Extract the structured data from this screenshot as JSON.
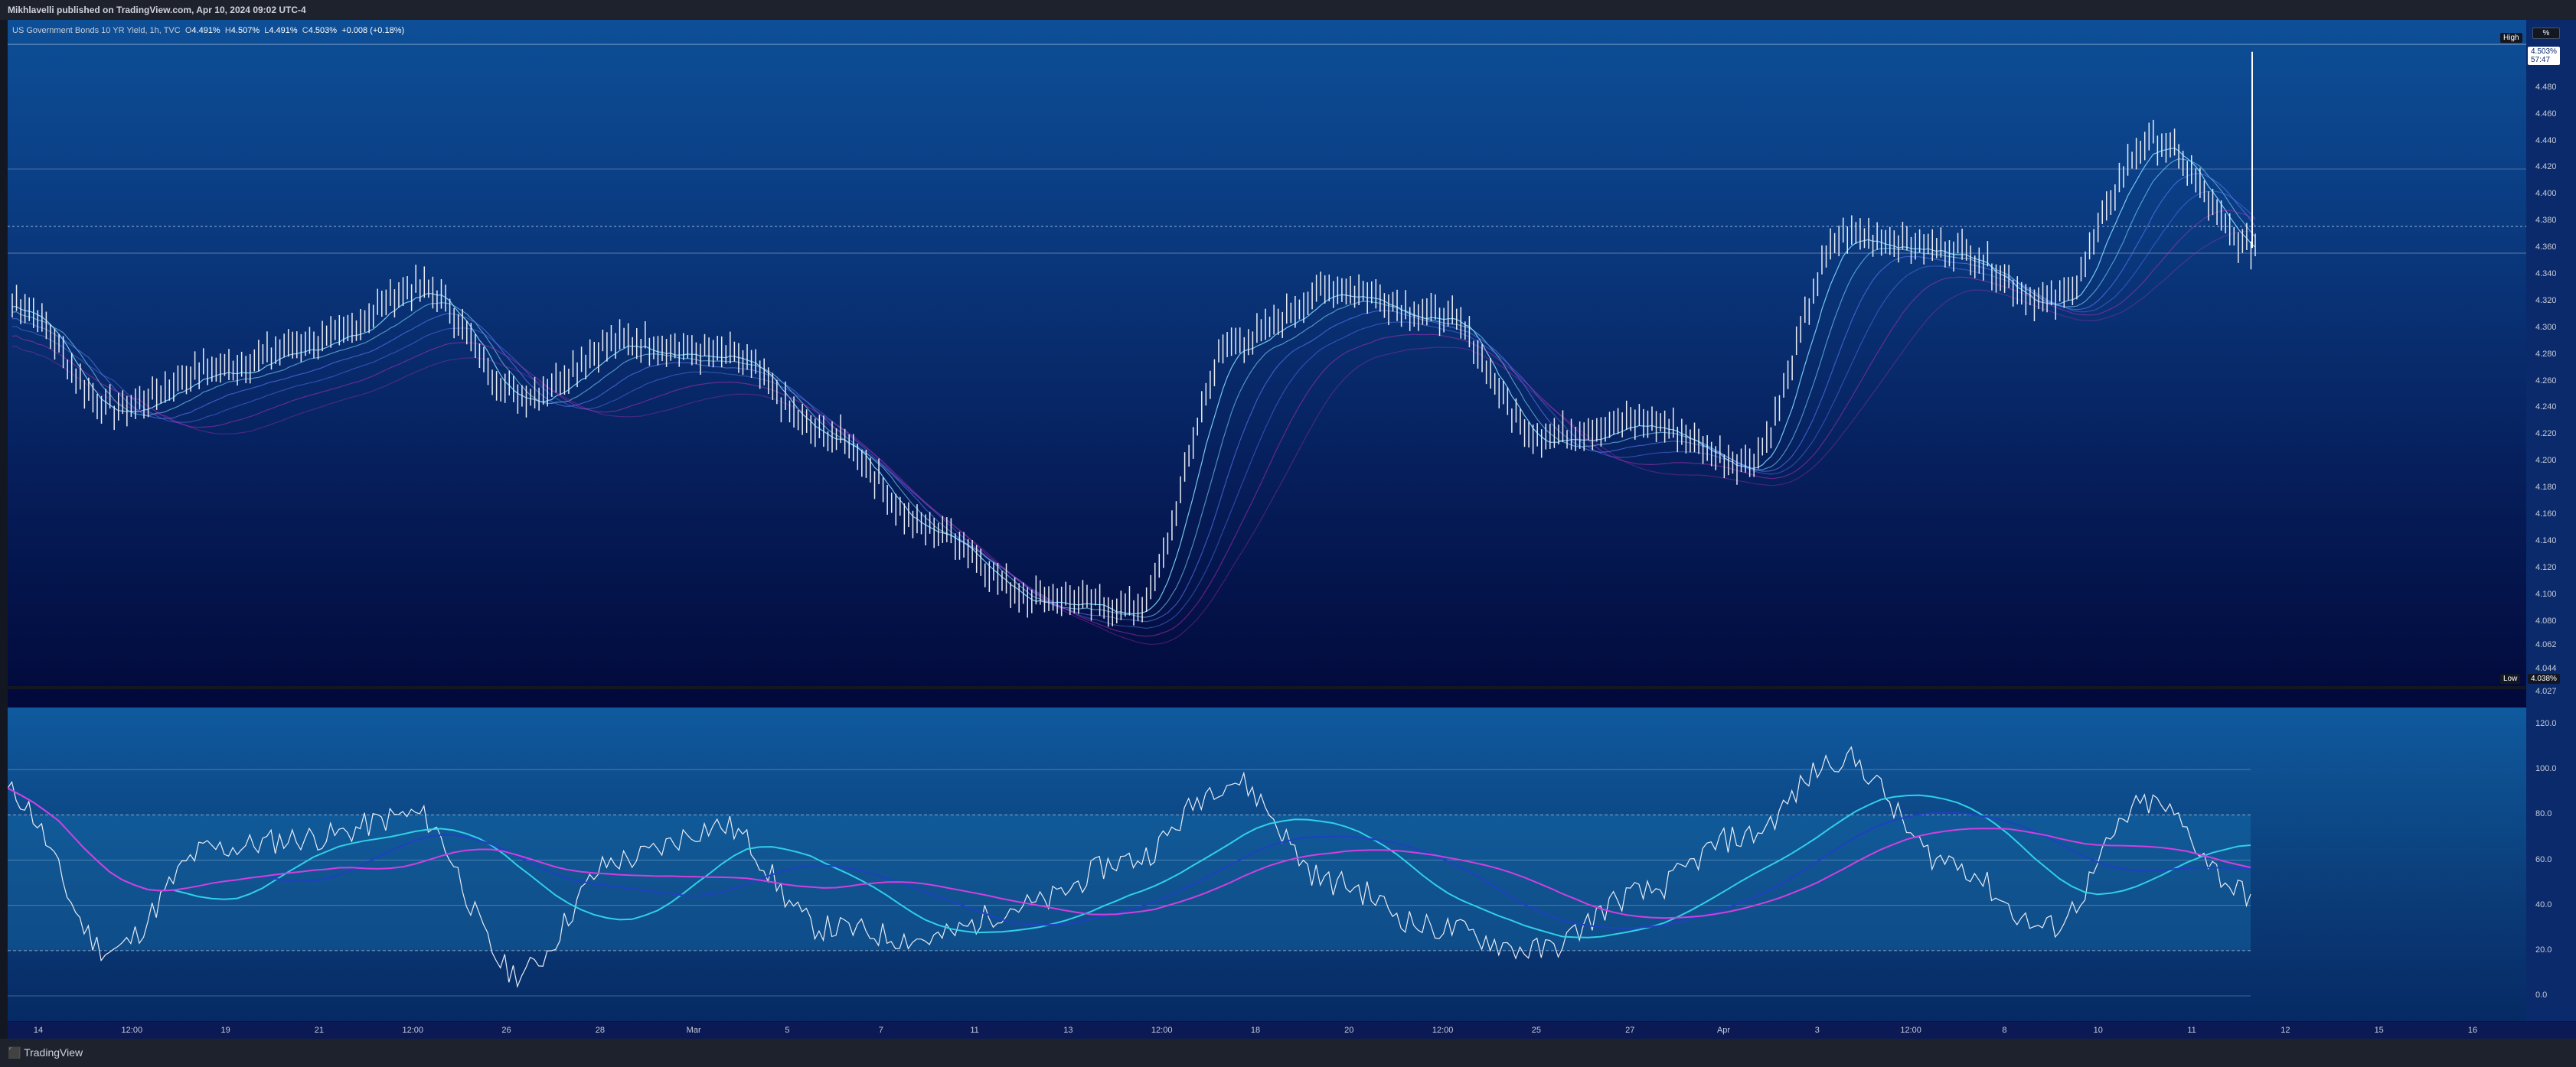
{
  "header": {
    "published_text": "Mikhlavelli published on TradingView.com, Apr 10, 2024 09:02 UTC-4"
  },
  "symbol": {
    "name": "US Government Bonds 10 YR Yield, 1h, TVC",
    "open_label": "O",
    "open": "4.491%",
    "high_label": "H",
    "high": "4.507%",
    "low_label": "L",
    "low": "4.491%",
    "close_label": "C",
    "close": "4.503%",
    "change": "+0.008 (+0.18%)"
  },
  "price_axis": {
    "unit_button": "%",
    "labels": [
      "4.480",
      "4.460",
      "4.440",
      "4.420",
      "4.400",
      "4.380",
      "4.360",
      "4.340",
      "4.320",
      "4.300",
      "4.280",
      "4.260",
      "4.240",
      "4.220",
      "4.200",
      "4.180",
      "4.160",
      "4.140",
      "4.120",
      "4.100",
      "4.080",
      "4.062",
      "4.044",
      "4.027"
    ],
    "last_price": "4.503%",
    "countdown": "57:47",
    "high_tag": "High",
    "low_tag": "Low",
    "low_value": "4.038%"
  },
  "osc_axis": {
    "labels": [
      "120.0",
      "100.0",
      "80.0",
      "60.0",
      "40.0",
      "20.0",
      "0.0"
    ]
  },
  "time_axis": {
    "labels": [
      "14",
      "12:00",
      "19",
      "21",
      "12:00",
      "26",
      "28",
      "Mar",
      "5",
      "7",
      "11",
      "13",
      "12:00",
      "18",
      "20",
      "12:00",
      "25",
      "27",
      "Apr",
      "3",
      "12:00",
      "8",
      "10",
      "11",
      "12",
      "15",
      "16"
    ]
  },
  "footer": {
    "brand": "TradingView"
  },
  "colors": {
    "price_line": "#e8ecf5",
    "ribbon_light": "#7fd8ff",
    "ribbon_mid": "#5f7dff",
    "ribbon_dark": "#c030c0",
    "osc_cyan": "#30d0e8",
    "osc_blue": "#2040c0",
    "osc_magenta": "#d040e0"
  },
  "chart_data": {
    "type": "line",
    "title": "US Government Bonds 10 YR Yield, 1h, TVC",
    "ylim": [
      4.027,
      4.508
    ],
    "x": [
      "14",
      "12:00",
      "19",
      "21",
      "12:00",
      "26",
      "28",
      "Mar",
      "5",
      "7",
      "11",
      "13",
      "12:00",
      "18",
      "20",
      "12:00",
      "25",
      "27",
      "Apr",
      "3",
      "12:00",
      "8",
      "10"
    ],
    "series": [
      {
        "values": [
          4.32,
          4.24,
          4.27,
          4.29,
          4.33,
          4.25,
          4.29,
          4.28,
          4.22,
          4.15,
          4.1,
          4.09,
          4.29,
          4.33,
          4.31,
          4.22,
          4.23,
          4.2,
          4.37,
          4.36,
          4.32,
          4.44,
          4.36
        ]
      }
    ],
    "oscillator": {
      "ylim": [
        0,
        120
      ],
      "levels": [
        80,
        20
      ],
      "values": [
        90,
        20,
        65,
        70,
        80,
        10,
        60,
        75,
        30,
        25,
        40,
        60,
        95,
        50,
        30,
        20,
        45,
        70,
        105,
        60,
        30,
        85,
        45
      ]
    }
  }
}
